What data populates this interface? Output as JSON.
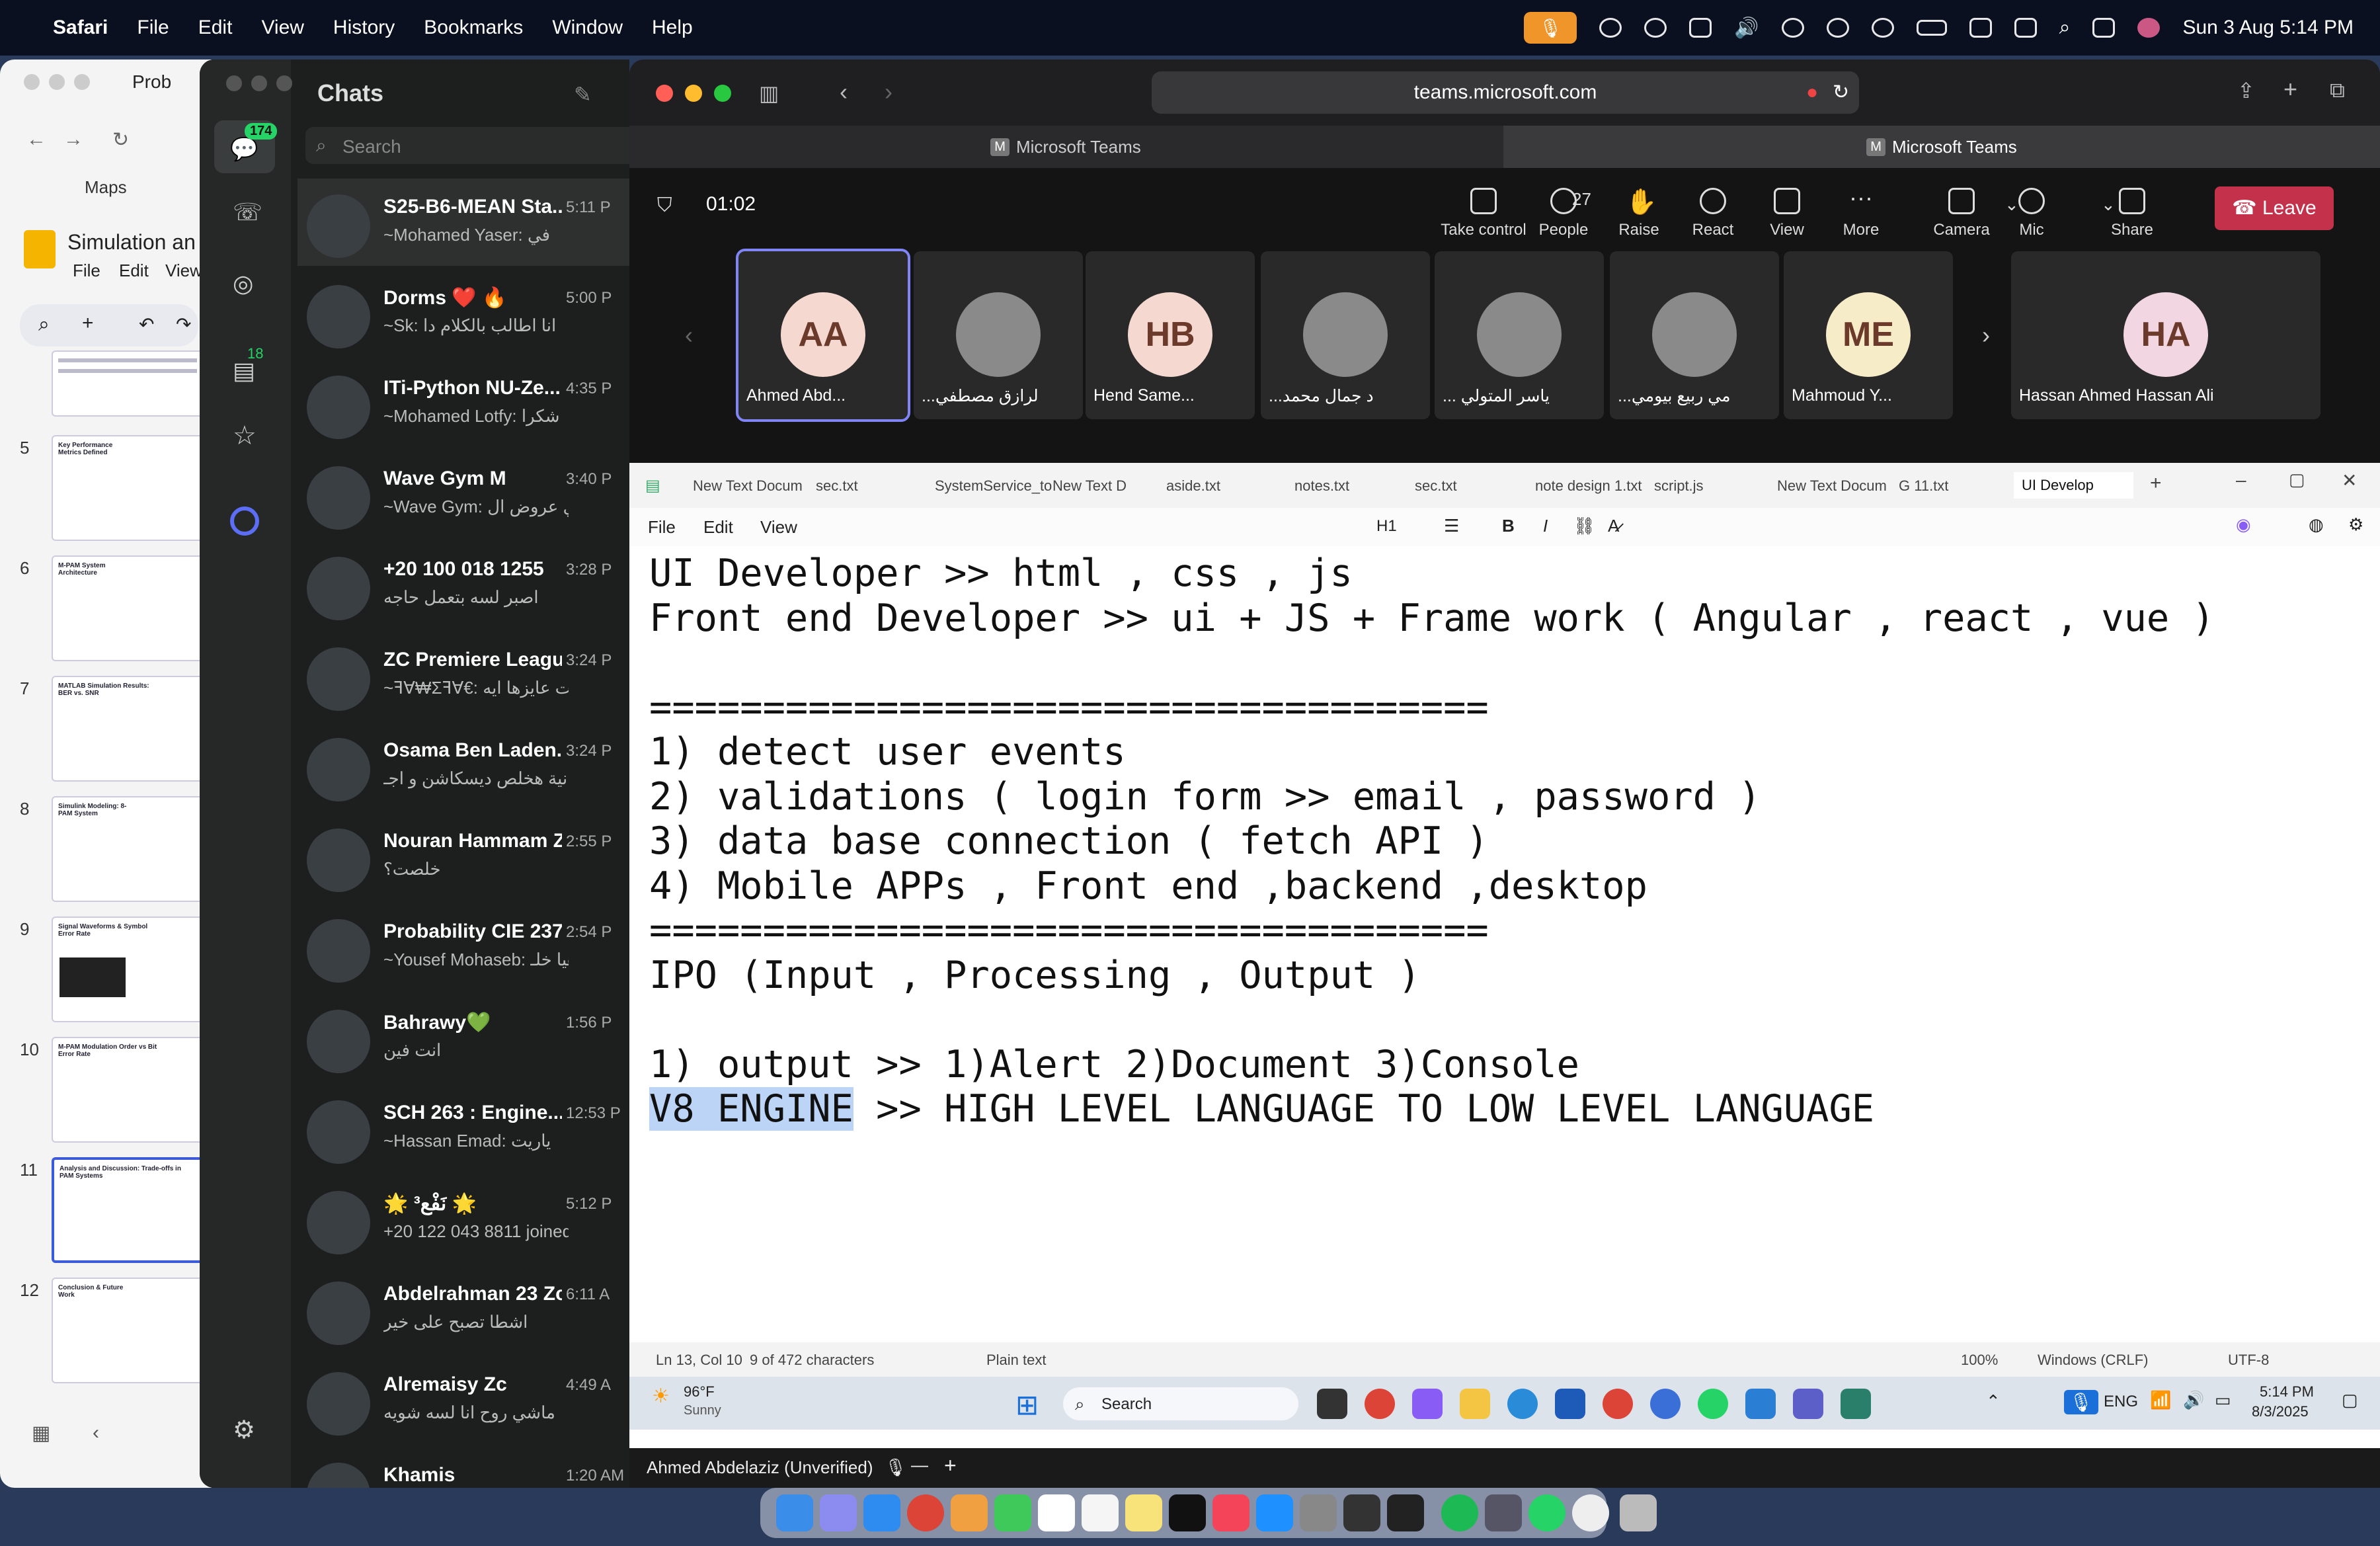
{
  "menubar": {
    "app": "Safari",
    "items": [
      "File",
      "Edit",
      "View",
      "History",
      "Bookmarks",
      "Window",
      "Help"
    ],
    "datetime": "Sun 3 Aug  5:14 PM"
  },
  "slides": {
    "app_title": "Simulation an",
    "menu": [
      "File",
      "Edit",
      "View"
    ],
    "tab_title": "Prob",
    "nav": [
      "Maps"
    ],
    "numbers": [
      "5",
      "6",
      "7",
      "8",
      "9",
      "10",
      "11",
      "12"
    ],
    "titles": [
      "Key Performance Metrics Defined",
      "M-PAM System Architecture",
      "MATLAB Simulation Results: BER vs. SNR",
      "Simulink Modeling: 8-PAM System",
      "Signal Waveforms & Symbol Error Rate",
      "M-PAM Modulation Order vs Bit Error Rate",
      "Analysis and Discussion: Trade-offs in PAM Systems",
      "Conclusion & Future Work"
    ]
  },
  "whatsapp": {
    "title": "Chats",
    "unread_badge": "174",
    "status_badge": "18",
    "search_placeholder": "Search",
    "chats": [
      {
        "name": "S25-B6-MEAN Sta...",
        "time": "5:11 P",
        "preview": "~Mohamed Yaser: في"
      },
      {
        "name": "Dorms ❤️ 🔥",
        "time": "5:00 P",
        "preview": "~Sk: انا اطالب بالكلام دا"
      },
      {
        "name": "ITi-Python NU-Ze...",
        "time": "4:35 P",
        "preview": "~Mohamed Lotfy: شكرا"
      },
      {
        "name": "Wave Gym M",
        "time": "3:40 P",
        "preview": "~Wave Gym: اقوي عروض ال..."
      },
      {
        "name": "+20 100 018 1255",
        "time": "3:28 P",
        "preview": "اصبر لسه بتعمل حاجه"
      },
      {
        "name": "ZC Premiere League",
        "time": "3:24 P",
        "preview": "~ꟻⱯ₩ƩꟻⱯ€: انت عايزها ايه..."
      },
      {
        "name": "Osama Ben Laden...",
        "time": "3:24 P",
        "preview": "ثانية هخلص ديسكاشن و اجـ..."
      },
      {
        "name": "Nouran Hammam Zc",
        "time": "2:55 P",
        "preview": "خلصت؟"
      },
      {
        "name": "Probability CIE 237",
        "time": "2:54 P",
        "preview": "~Yousef Mohaseb: هيا خلـ..."
      },
      {
        "name": "Bahrawy💚",
        "time": "1:56 P",
        "preview": "انت فين"
      },
      {
        "name": "SCH 263 : Engine...",
        "time": "12:53 P",
        "preview": "~Hassan Emad: ياريت"
      },
      {
        "name": "🌟 نَفْع³ 🌟",
        "time": "5:12 P",
        "preview": "+20 122 043 8811 joined u..."
      },
      {
        "name": "Abdelrahman 23 Zc",
        "time": "6:11 A",
        "preview": "اشطا تصبح على خير"
      },
      {
        "name": "Alremaisy Zc",
        "time": "4:49 A",
        "preview": "ماشي روح انا لسه شويه"
      },
      {
        "name": "Khamis",
        "time": "1:20 AM",
        "preview": ""
      }
    ]
  },
  "browser": {
    "url": "teams.microsoft.com",
    "tabs": [
      "Microsoft Teams",
      "Microsoft Teams"
    ]
  },
  "teams": {
    "timer": "01:02",
    "people_count": "27",
    "controls": [
      "Take control",
      "People",
      "Raise",
      "React",
      "View",
      "More",
      "Camera",
      "Mic",
      "Share"
    ],
    "leave_label": "Leave",
    "participants": [
      {
        "initials": "AA",
        "name": "Ahmed Abd...",
        "color": "#f5d9d0"
      },
      {
        "initials": "",
        "name": "...لرازق مصطفي",
        "color": "#8a8a8a"
      },
      {
        "initials": "HB",
        "name": "Hend Same...",
        "color": "#f5d9d0"
      },
      {
        "initials": "",
        "name": "...د جمال محمد",
        "color": "#8a8a8a"
      },
      {
        "initials": "",
        "name": "... ياسر المتولي",
        "color": "#8a8a8a"
      },
      {
        "initials": "",
        "name": "...مي ربيع بيومي",
        "color": "#8a8a8a"
      },
      {
        "initials": "ME",
        "name": "Mahmoud Y...",
        "color": "#f7ecc8"
      },
      {
        "initials": "HA",
        "name": "Hassan Ahmed Hassan Ali",
        "color": "#f2d6e2"
      }
    ]
  },
  "notepad": {
    "tabs": [
      "New Text Docum",
      "sec.txt",
      "SystemService_to",
      "New Text D",
      "aside.txt",
      "notes.txt",
      "sec.txt",
      "note design 1.txt",
      "script.js",
      "New Text Docum",
      "G 11.txt",
      "UI Develop"
    ],
    "menu": [
      "File",
      "Edit",
      "View"
    ],
    "heading": "H1",
    "lines": [
      "UI Developer >> html , css , js",
      "Front end Developer >> ui + JS + Frame work ( Angular , react , vue )",
      "",
      "=====================================",
      "1) detect user events",
      "2) validations ( login form >> email , password )",
      "3) data base connection ( fetch API )",
      "4) Mobile APPs , Front end ,backend ,desktop",
      "=====================================",
      "IPO (Input , Processing , Output )",
      "",
      "1) output >> 1)Alert 2)Document 3)Console"
    ],
    "last_line_selected": "V8 ENGINE",
    "last_line_rest": " >> HIGH LEVEL LANGUAGE TO LOW LEVEL LANGUAGE",
    "status": {
      "pos": "Ln 13, Col 10",
      "chars": "9 of 472 characters",
      "format": "Plain text",
      "zoom": "100%",
      "eol": "Windows (CRLF)",
      "enc": "UTF-8"
    }
  },
  "windows_taskbar": {
    "weather_temp": "96°F",
    "weather_desc": "Sunny",
    "search": "Search",
    "lang": "ENG",
    "time": "5:14 PM",
    "date": "8/3/2025"
  },
  "share_strip": "Ahmed Abdelaziz (Unverified)"
}
